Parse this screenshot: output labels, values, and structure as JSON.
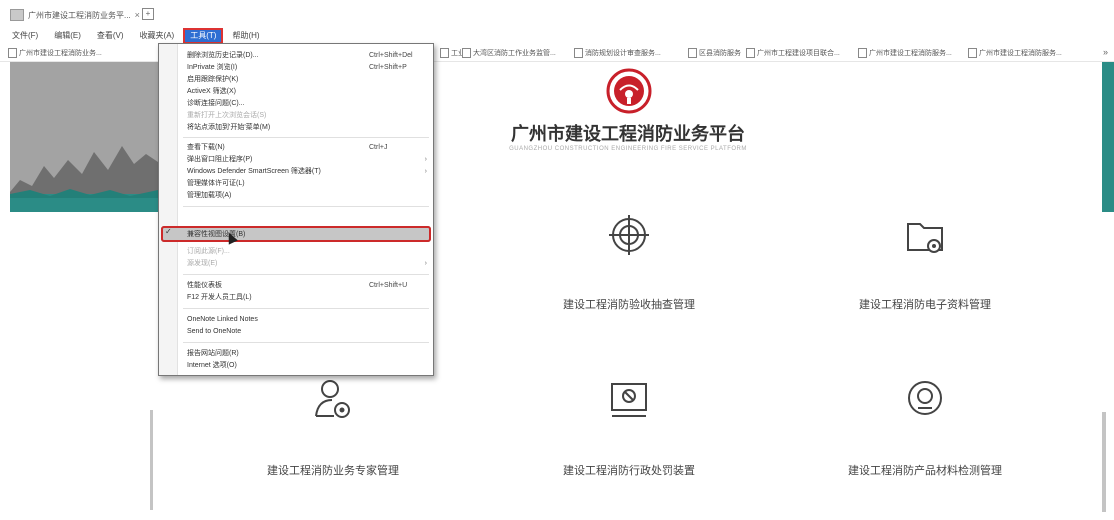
{
  "browser": {
    "tab_title": "广州市建设工程消防业务平...",
    "tab_close": "×",
    "newtab": "+",
    "menu": [
      "文件(F)",
      "编辑(E)",
      "查看(V)",
      "收藏夹(A)",
      "工具(T)",
      "帮助(H)"
    ],
    "favorites": [
      "广州市建设工程消防业务...",
      "工业",
      "大湾区消防工作业务监管...",
      "消防规划设计审查服务...",
      "区县消防服务",
      "广州市工程建设项目联合...",
      "广州市建设工程消防服务...",
      "广州市建设工程消防服务..."
    ],
    "fav_more": "»"
  },
  "tools_menu": {
    "items": [
      {
        "label": "删除浏览历史记录(D)...",
        "shortcut": "Ctrl+Shift+Del"
      },
      {
        "label": "InPrivate 浏览(I)",
        "shortcut": "Ctrl+Shift+P"
      },
      {
        "label": "启用跟踪保护(K)",
        "shortcut": ""
      },
      {
        "label": "ActiveX 筛选(X)",
        "shortcut": ""
      },
      {
        "label": "诊断连接问题(C)...",
        "shortcut": ""
      },
      {
        "label": "重新打开上次浏览会话(S)",
        "shortcut": "",
        "disabled": true
      },
      {
        "label": "将站点添加到'开始'菜单(M)",
        "shortcut": ""
      },
      {
        "label": "查看下载(N)",
        "shortcut": "Ctrl+J"
      },
      {
        "label": "弹出窗口阻止程序(P)",
        "shortcut": "",
        "arrow": "›"
      },
      {
        "label": "Windows Defender SmartScreen 筛选器(T)",
        "shortcut": "",
        "arrow": "›"
      },
      {
        "label": "管理媒体许可证(L)",
        "shortcut": ""
      },
      {
        "label": "管理加载项(A)",
        "shortcut": ""
      },
      {
        "label": "兼容性视图设置(B)",
        "shortcut": "",
        "highlighted": true
      },
      {
        "label": "订阅此源(F)...",
        "shortcut": "",
        "disabled": true
      },
      {
        "label": "源发现(E)",
        "shortcut": "",
        "arrow": "›",
        "disabled": true
      },
      {
        "label": "性能仪表板",
        "shortcut": "Ctrl+Shift+U"
      },
      {
        "label": "F12 开发人员工具(L)",
        "shortcut": ""
      },
      {
        "label": "OneNote Linked Notes",
        "shortcut": ""
      },
      {
        "label": "Send to OneNote",
        "shortcut": ""
      },
      {
        "label": "报告网站问题(R)",
        "shortcut": ""
      },
      {
        "label": "Internet 选项(O)",
        "shortcut": ""
      }
    ],
    "check_mark": "✓"
  },
  "header": {
    "title": "广州市建设工程消防业务平台",
    "subtitle": "GUANGZHOU CONSTRUCTION ENGINEERING FIRE SERVICE PLATFORM"
  },
  "modules": [
    {
      "label": "建设工程消防验收抽查管理",
      "icon": "target-icon"
    },
    {
      "label": "建设工程消防电子资料管理",
      "icon": "folder-gear-icon"
    },
    {
      "label": "建设工程消防业务专家管理",
      "icon": "user-gear-icon"
    },
    {
      "label": "建设工程消防行政处罚装置",
      "icon": "monitor-icon"
    },
    {
      "label": "建设工程消防产品材料检测管理",
      "icon": "inspect-icon"
    }
  ],
  "colors": {
    "accent": "#2e6fd3",
    "highlight_outline": "#cc2a2a",
    "logo_red": "#c8202a",
    "teal": "#2b8c86"
  }
}
